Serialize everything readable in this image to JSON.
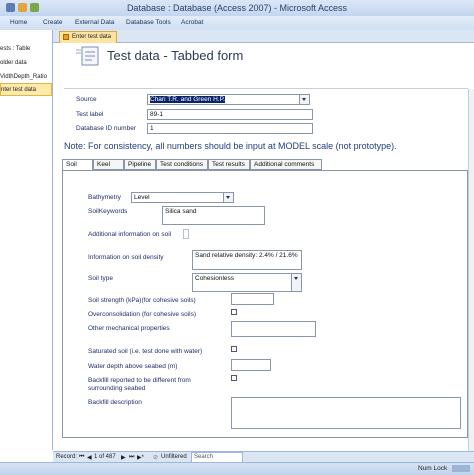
{
  "window": {
    "title": "Database : Database (Access 2007) - Microsoft Access"
  },
  "ribbon": {
    "tabs": [
      "Home",
      "Create",
      "External Data",
      "Database Tools",
      "Acrobat"
    ]
  },
  "nav_pane": {
    "items": [
      "ests : Table",
      "older data",
      "VidthDepth_Ratio",
      "nter test data"
    ],
    "selected_index": 3
  },
  "document_tab": {
    "label": "Enter test data"
  },
  "form": {
    "title": "Test data - Tabbed form",
    "source_label": "Source",
    "source_value": "Chari T.R. and Green H.P.",
    "test_label_label": "Test label",
    "test_label_value": "89-1",
    "db_id_label": "Database ID number",
    "db_id_value": "1",
    "note": "Note: For consistency, all numbers should be input at MODEL scale (not prototype).",
    "tabs": [
      "Soil",
      "Keel",
      "Pipeline",
      "Test conditions",
      "Test results",
      "Additional comments"
    ],
    "active_tab": 0
  },
  "soil": {
    "bathymetry_label": "Bathymetry",
    "bathymetry_value": "Level",
    "keywords_label": "SoilKeywords",
    "keywords_value": "Silica sand",
    "additional_info_label": "Additional information on soil",
    "density_label": "Information on soil density",
    "density_value": "Sand relative density: 2.4% / 21.6%",
    "soil_type_label": "Soil type",
    "soil_type_value": "Cohesionless",
    "strength_label": "Soil strength (kPa)(for cohesive soils)",
    "overconsolidation_label": "Overconsolidation (for cohesive soils)",
    "other_props_label": "Other mechanical properties",
    "saturated_label": "Saturated soil (i.e. test done with water)",
    "water_depth_label": "Water depth above seabed (m)",
    "backfill_label_1": "Backfill reported to be different from",
    "backfill_label_2": "surrounding seabed",
    "backfill_desc_label": "Backfill description"
  },
  "record_nav": {
    "record_label": "Record:",
    "position": "1 of 487",
    "filter_status": "Unfiltered",
    "search_placeholder": "Search"
  },
  "status_bar": {
    "num_lock": "Num Lock"
  },
  "colors": {
    "access_accent": "#1f3f7a",
    "selected_nav": "#fde9a8"
  }
}
